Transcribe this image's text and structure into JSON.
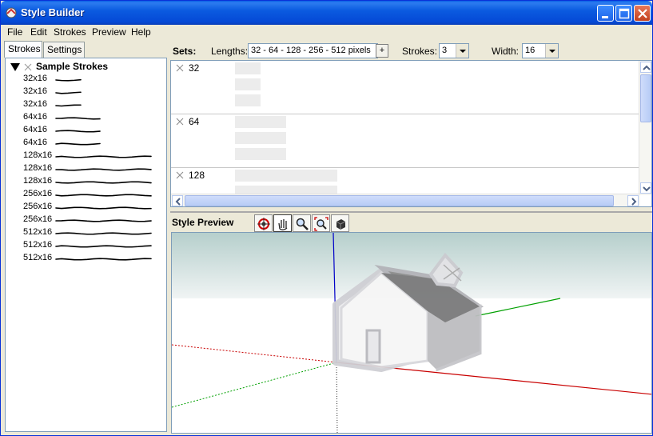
{
  "window": {
    "title": "Style Builder",
    "accent": "#0a5fe5"
  },
  "menu": [
    "File",
    "Edit",
    "Strokes",
    "Preview",
    "Help"
  ],
  "left_tabs": [
    {
      "label": "Strokes",
      "active": true
    },
    {
      "label": "Settings",
      "active": false
    }
  ],
  "stroke_tree": {
    "root_label": "Sample Strokes",
    "items": [
      "32x16",
      "32x16",
      "32x16",
      "64x16",
      "64x16",
      "64x16",
      "128x16",
      "128x16",
      "128x16",
      "256x16",
      "256x16",
      "256x16",
      "512x16",
      "512x16",
      "512x16"
    ]
  },
  "sets_toolbar": {
    "sets_label": "Sets:",
    "lengths_label": "Lengths:",
    "lengths_value": "32 - 64 - 128 - 256 - 512 pixels",
    "add_label": "+",
    "strokes_label": "Strokes:",
    "strokes_value": "3",
    "width_label": "Width:",
    "width_value": "16"
  },
  "sets": [
    {
      "label": "32"
    },
    {
      "label": "64"
    },
    {
      "label": "128"
    }
  ],
  "preview": {
    "title": "Style Preview",
    "tools": [
      "orbit-icon",
      "pan-icon",
      "zoom-icon",
      "zoom-extents-icon",
      "style-icon"
    ]
  },
  "colors": {
    "axis_red": "#c80000",
    "axis_green": "#00a000",
    "axis_blue": "#0000c8",
    "sky": "#bcd4d2"
  }
}
